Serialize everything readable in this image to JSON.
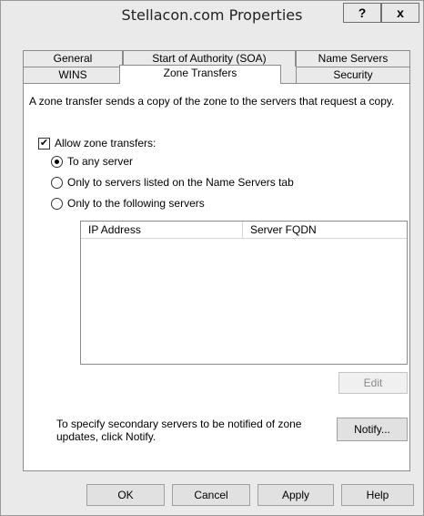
{
  "window": {
    "title": "Stellacon.com Properties",
    "help_label": "?",
    "close_label": "x"
  },
  "tabs": {
    "row1": [
      "General",
      "Start of Authority (SOA)",
      "Name Servers"
    ],
    "row2": [
      "WINS",
      "Zone Transfers",
      "Security"
    ],
    "active": "Zone Transfers"
  },
  "panel": {
    "description": "A zone transfer sends a copy of the zone to the servers that request a copy.",
    "allow_label": "Allow zone transfers:",
    "allow_checked": true,
    "options": [
      {
        "label": "To any server",
        "selected": true
      },
      {
        "label": "Only to servers listed on the Name Servers tab",
        "selected": false
      },
      {
        "label": "Only to the following servers",
        "selected": false
      }
    ],
    "list_columns": [
      "IP Address",
      "Server FQDN"
    ],
    "edit_label": "Edit",
    "notify_text_line1": "To specify secondary servers to be notified of zone",
    "notify_text_line2": "updates, click Notify.",
    "notify_label": "Notify..."
  },
  "footer": {
    "ok_label": "OK",
    "cancel_label": "Cancel",
    "apply_label": "Apply",
    "help_label": "Help"
  }
}
